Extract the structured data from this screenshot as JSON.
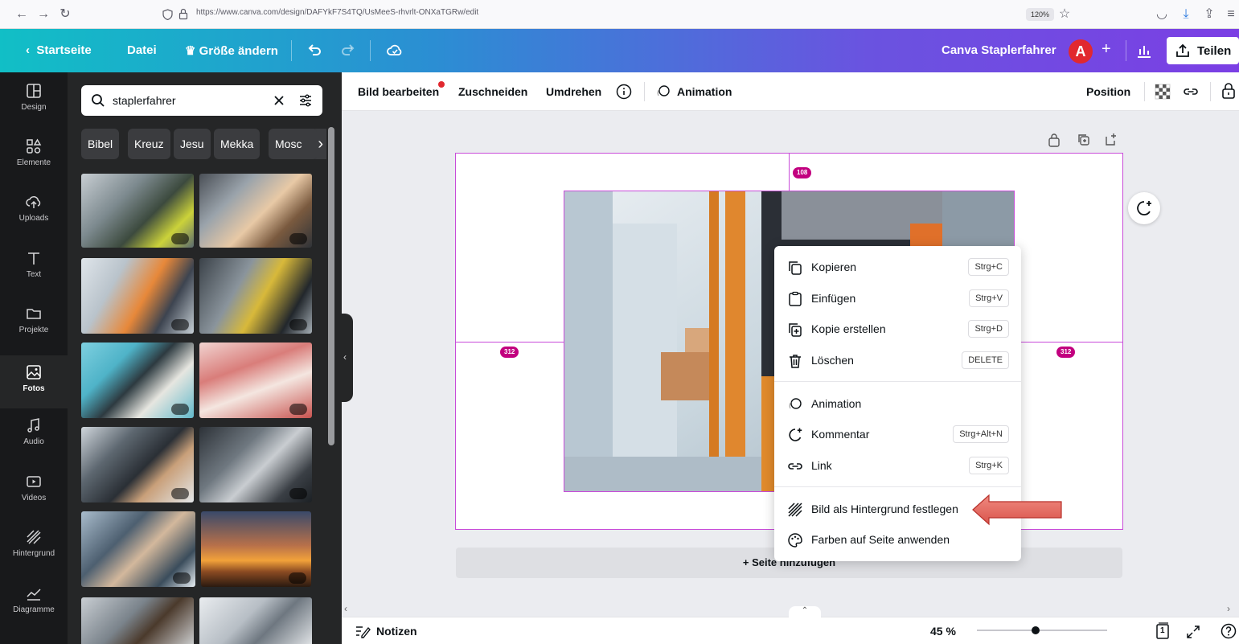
{
  "browser": {
    "url": "https://www.canva.com/design/DAFYkF7S4TQ/UsMeeS-rhvrlt-ONXaTGRw/edit",
    "zoom": "120%"
  },
  "topbar": {
    "home_label": "Startseite",
    "file_label": "Datei",
    "resize_label": "Größe ändern",
    "design_title": "Canva Staplerfahrer",
    "avatar_letter": "A",
    "share_label": "Teilen"
  },
  "rail": {
    "items": [
      {
        "label": "Design"
      },
      {
        "label": "Elemente"
      },
      {
        "label": "Uploads"
      },
      {
        "label": "Text"
      },
      {
        "label": "Projekte"
      },
      {
        "label": "Fotos"
      },
      {
        "label": "Audio"
      },
      {
        "label": "Videos"
      },
      {
        "label": "Hintergrund"
      },
      {
        "label": "Diagramme"
      }
    ],
    "active": "Fotos"
  },
  "panel": {
    "search_value": "staplerfahrer",
    "chips": [
      "Bibel",
      "Kreuz",
      "Jesu",
      "Mekka",
      "Mosc"
    ]
  },
  "toolbar": {
    "edit_image": "Bild bearbeiten",
    "crop": "Zuschneiden",
    "flip": "Umdrehen",
    "animation": "Animation",
    "position": "Position"
  },
  "canvas": {
    "top_distance": "108",
    "left_distance": "312",
    "right_distance": "312",
    "add_page": "+ Seite hinzufügen"
  },
  "context_menu": {
    "items": [
      {
        "label": "Kopieren",
        "shortcut": "Strg+C"
      },
      {
        "label": "Einfügen",
        "shortcut": "Strg+V"
      },
      {
        "label": "Kopie erstellen",
        "shortcut": "Strg+D"
      },
      {
        "label": "Löschen",
        "shortcut": "DELETE"
      },
      {
        "label": "Animation",
        "shortcut": ""
      },
      {
        "label": "Kommentar",
        "shortcut": "Strg+Alt+N"
      },
      {
        "label": "Link",
        "shortcut": "Strg+K"
      },
      {
        "label": "Bild als Hintergrund festlegen",
        "shortcut": ""
      },
      {
        "label": "Farben auf Seite anwenden",
        "shortcut": ""
      }
    ]
  },
  "bottombar": {
    "notes_label": "Notizen",
    "zoom_label": "45 %",
    "zoom_level": 0.45,
    "page_count": "1"
  },
  "colors": {
    "accent": "#8b3dff",
    "selection": "#c84bd9",
    "badge": "#c2007f",
    "arrow": "#e8675f"
  }
}
